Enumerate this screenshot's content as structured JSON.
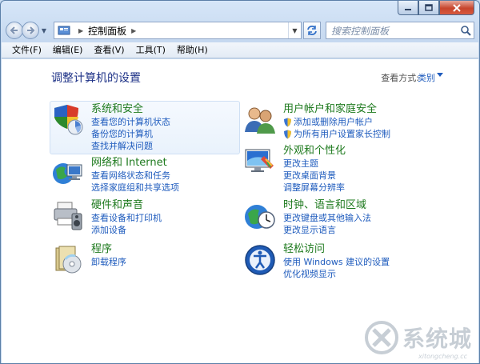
{
  "window": {
    "controls": {
      "minimize": "minimize-icon",
      "maximize": "maximize-icon",
      "close": "close-icon"
    }
  },
  "address_bar": {
    "crumbs": [
      "控制面板"
    ],
    "icons": [
      "back-icon",
      "forward-icon",
      "control-panel-icon",
      "refresh-icon"
    ]
  },
  "search": {
    "placeholder": "搜索控制面板",
    "icon": "search-icon"
  },
  "menu": [
    "文件(F)",
    "编辑(E)",
    "查看(V)",
    "工具(T)",
    "帮助(H)"
  ],
  "page_title": "调整计算机的设置",
  "view_by": {
    "label": "查看方式:",
    "value": "类别"
  },
  "categories": [
    {
      "title": "系统和安全",
      "icon": "system-security-icon",
      "links": [
        "查看您的计算机状态",
        "备份您的计算机",
        "查找并解决问题"
      ]
    },
    {
      "title": "网络和 Internet",
      "icon": "network-internet-icon",
      "links": [
        "查看网络状态和任务",
        "选择家庭组和共享选项"
      ]
    },
    {
      "title": "硬件和声音",
      "icon": "hardware-sound-icon",
      "links": [
        "查看设备和打印机",
        "添加设备"
      ]
    },
    {
      "title": "程序",
      "icon": "programs-icon",
      "links": [
        "卸载程序"
      ]
    },
    {
      "title": "用户帐户和家庭安全",
      "icon": "user-accounts-icon",
      "links": [
        "添加或删除用户帐户",
        "为所有用户设置家长控制"
      ]
    },
    {
      "title": "外观和个性化",
      "icon": "appearance-icon",
      "links": [
        "更改主题",
        "更改桌面背景",
        "调整屏幕分辨率"
      ]
    },
    {
      "title": "时钟、语言和区域",
      "icon": "clock-region-icon",
      "links": [
        "更改键盘或其他输入法",
        "更改显示语言"
      ]
    },
    {
      "title": "轻松访问",
      "icon": "ease-of-access-icon",
      "links": [
        "使用 Windows 建议的设置",
        "优化视频显示"
      ]
    }
  ],
  "watermark": {
    "text": "系统城",
    "sub": "xitongcheng.cc"
  }
}
